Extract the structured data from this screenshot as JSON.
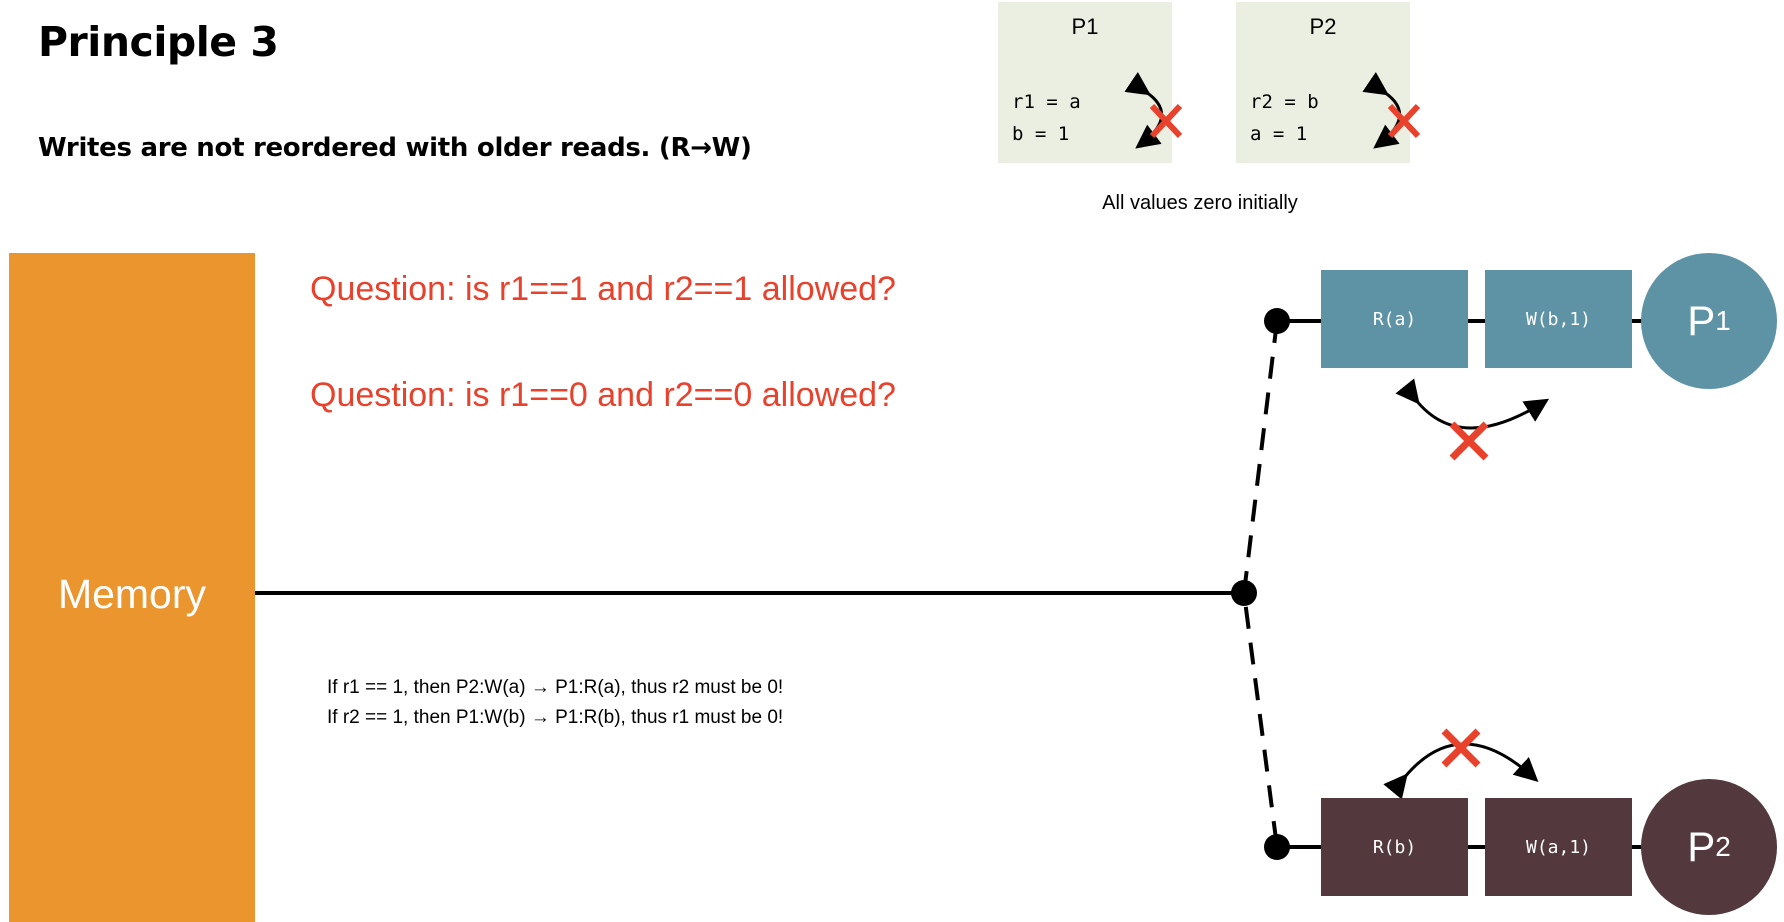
{
  "title": "Principle 3",
  "subtitle": "Writes are not reordered with older reads. (R→W)",
  "example": {
    "p1": {
      "label": "P1",
      "code": "r1 = a\nb = 1"
    },
    "p2": {
      "label": "P2",
      "code": "r2 = b\na = 1"
    },
    "note": "All values zero initially"
  },
  "memory_label": "Memory",
  "questions": [
    "Question: is r1==1 and r2==1 allowed?",
    "Question: is r1==0 and r2==0 allowed?"
  ],
  "explanations": [
    "If r1 == 1, then P2:W(a) → P1:R(a), thus r2 must be 0!",
    "If r2 == 1, then P1:W(b) → P1:R(b), thus r1 must be 0!"
  ],
  "processors": [
    {
      "name": "P",
      "sub": "1",
      "ops": [
        "R(a)",
        "W(b,1)"
      ],
      "color": "#5E93A6"
    },
    {
      "name": "P",
      "sub": "2",
      "ops": [
        "R(b)",
        "W(a,1)"
      ],
      "color": "#53393E"
    }
  ],
  "colors": {
    "accent": "#E8412C",
    "memory": "#EA952D"
  }
}
